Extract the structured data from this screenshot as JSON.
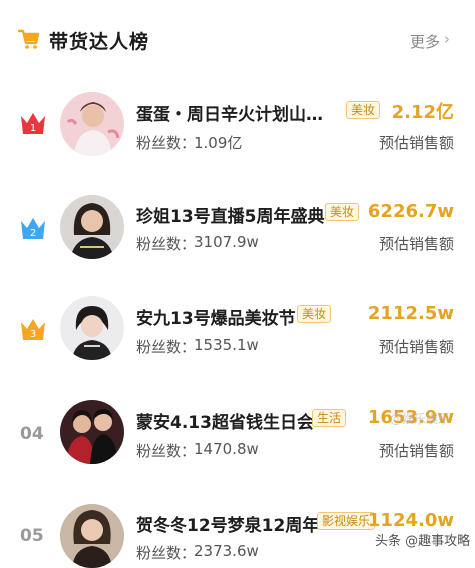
{
  "header": {
    "title": "带货达人榜",
    "more_label": "更多",
    "more_chevron": "›",
    "icon": "shopping-cart-icon",
    "accent": "#f5a623"
  },
  "rows": [
    {
      "rank": "1",
      "rank_style": "crown-red",
      "name": "蛋蛋・周日辛火计划山…",
      "tag": "美妆",
      "fans_label": "粉丝数：",
      "fans": "1.09亿",
      "sales": "2.12亿",
      "sales_label": "预估销售额"
    },
    {
      "rank": "2",
      "rank_style": "crown-blue",
      "name": "珍姐13号直播5周年盛典",
      "tag": "美妆",
      "fans_label": "粉丝数：",
      "fans": "3107.9w",
      "sales": "6226.7w",
      "sales_label": "预估销售额"
    },
    {
      "rank": "3",
      "rank_style": "crown-orange",
      "name": "安九13号爆品美妆节",
      "tag": "美妆",
      "fans_label": "粉丝数：",
      "fans": "1535.1w",
      "sales": "2112.5w",
      "sales_label": "预估销售额"
    },
    {
      "rank": "04",
      "rank_style": "number",
      "name": "蒙安4.13超省钱生日会",
      "tag": "生活",
      "fans_label": "粉丝数：",
      "fans": "1470.8w",
      "sales": "1653.9w",
      "sales_label": "预估销售额"
    },
    {
      "rank": "05",
      "rank_style": "number",
      "name": "贺冬冬12号梦泉12周年",
      "tag": "影视娱乐",
      "fans_label": "粉丝数：",
      "fans": "2373.6w",
      "sales": "1124.0w",
      "sales_label": ""
    }
  ],
  "watermark": "头条 @趣事攻略",
  "watermark_faint": "@娱乐娱乐"
}
